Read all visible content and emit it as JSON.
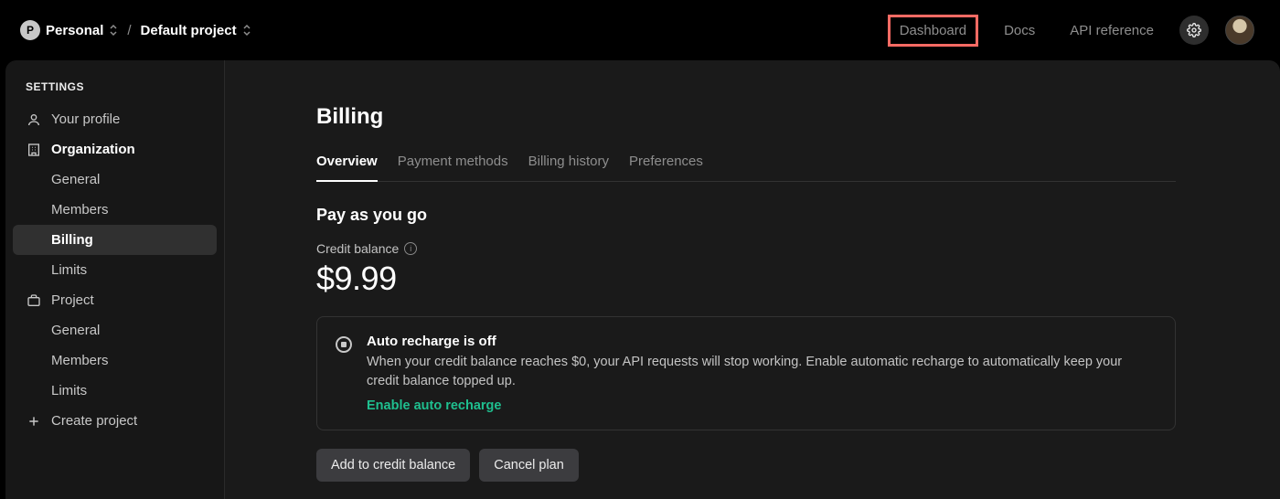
{
  "topbar": {
    "avatar_initial": "P",
    "org_label": "Personal",
    "project_label": "Default project",
    "nav": {
      "dashboard": "Dashboard",
      "docs": "Docs",
      "api_ref": "API reference"
    }
  },
  "sidebar": {
    "header": "SETTINGS",
    "your_profile": "Your profile",
    "organization": "Organization",
    "org_children": {
      "general": "General",
      "members": "Members",
      "billing": "Billing",
      "limits": "Limits"
    },
    "project": "Project",
    "proj_children": {
      "general": "General",
      "members": "Members",
      "limits": "Limits"
    },
    "create_project": "Create project"
  },
  "main": {
    "title": "Billing",
    "tabs": {
      "overview": "Overview",
      "payment": "Payment methods",
      "history": "Billing history",
      "prefs": "Preferences"
    },
    "section_title": "Pay as you go",
    "balance_label": "Credit balance",
    "balance_value": "$9.99",
    "notice": {
      "title": "Auto recharge is off",
      "text": "When your credit balance reaches $0, your API requests will stop working. Enable automatic recharge to automatically keep your credit balance topped up.",
      "link": "Enable auto recharge"
    },
    "buttons": {
      "add": "Add to credit balance",
      "cancel": "Cancel plan"
    }
  }
}
